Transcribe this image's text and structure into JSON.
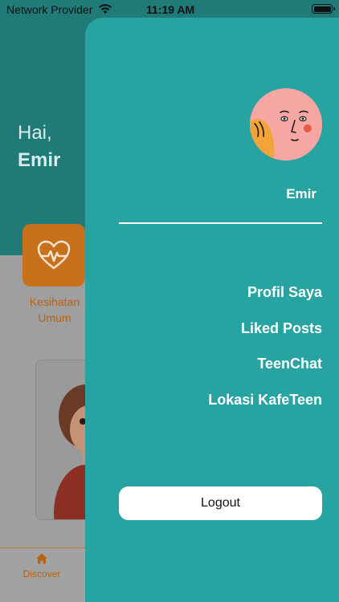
{
  "status_bar": {
    "carrier": "Network Provider",
    "time": "11:19 AM"
  },
  "background_app": {
    "greeting": "Hai,",
    "user_name": "Emir",
    "category": {
      "label": "Kesihatan Umum",
      "icon": "heart-pulse-icon"
    },
    "bottom_nav": {
      "discover_label": "Discover",
      "icon": "home-icon"
    }
  },
  "drawer": {
    "username": "Emir",
    "menu": [
      {
        "label": "Profil Saya"
      },
      {
        "label": "Liked Posts"
      },
      {
        "label": "TeenChat"
      },
      {
        "label": "Lokasi KafeTeen"
      }
    ],
    "logout_label": "Logout"
  },
  "colors": {
    "drawer_bg": "#27a3a2",
    "header_bg": "#1f7a78",
    "accent_orange": "#c8711c"
  }
}
